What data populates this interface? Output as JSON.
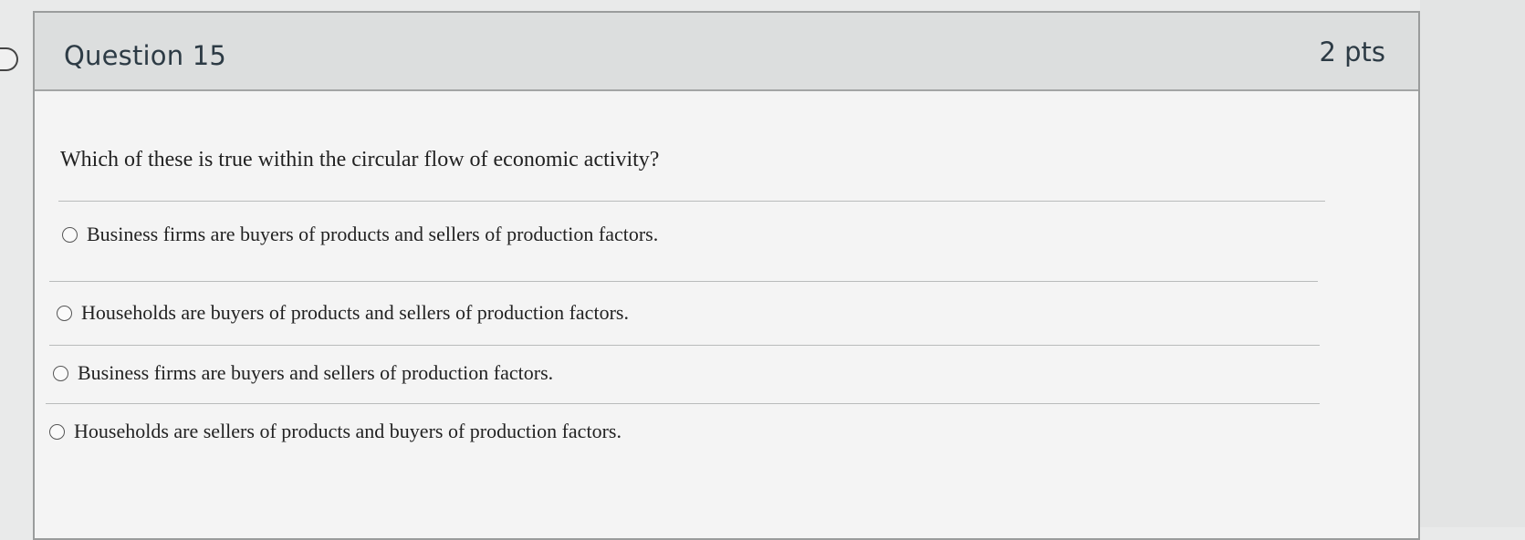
{
  "question": {
    "title": "Question 15",
    "points": "2 pts",
    "prompt": "Which of these is true within the circular flow of economic activity?"
  },
  "answers": [
    {
      "label": "Business firms are buyers of products and sellers of production factors.",
      "selected": false
    },
    {
      "label": "Households are buyers of products and sellers of production factors.",
      "selected": false
    },
    {
      "label": "Business firms are buyers and sellers of production factors.",
      "selected": false
    },
    {
      "label": "Households are sellers of products and buyers of production factors.",
      "selected": false
    }
  ]
}
